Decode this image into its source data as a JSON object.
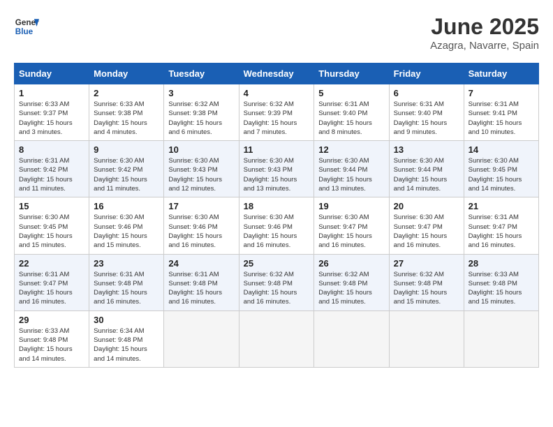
{
  "header": {
    "logo_line1": "General",
    "logo_line2": "Blue",
    "title": "June 2025",
    "subtitle": "Azagra, Navarre, Spain"
  },
  "weekdays": [
    "Sunday",
    "Monday",
    "Tuesday",
    "Wednesday",
    "Thursday",
    "Friday",
    "Saturday"
  ],
  "weeks": [
    [
      {
        "day": "1",
        "info": "Sunrise: 6:33 AM\nSunset: 9:37 PM\nDaylight: 15 hours\nand 3 minutes."
      },
      {
        "day": "2",
        "info": "Sunrise: 6:33 AM\nSunset: 9:38 PM\nDaylight: 15 hours\nand 4 minutes."
      },
      {
        "day": "3",
        "info": "Sunrise: 6:32 AM\nSunset: 9:38 PM\nDaylight: 15 hours\nand 6 minutes."
      },
      {
        "day": "4",
        "info": "Sunrise: 6:32 AM\nSunset: 9:39 PM\nDaylight: 15 hours\nand 7 minutes."
      },
      {
        "day": "5",
        "info": "Sunrise: 6:31 AM\nSunset: 9:40 PM\nDaylight: 15 hours\nand 8 minutes."
      },
      {
        "day": "6",
        "info": "Sunrise: 6:31 AM\nSunset: 9:40 PM\nDaylight: 15 hours\nand 9 minutes."
      },
      {
        "day": "7",
        "info": "Sunrise: 6:31 AM\nSunset: 9:41 PM\nDaylight: 15 hours\nand 10 minutes."
      }
    ],
    [
      {
        "day": "8",
        "info": "Sunrise: 6:31 AM\nSunset: 9:42 PM\nDaylight: 15 hours\nand 11 minutes."
      },
      {
        "day": "9",
        "info": "Sunrise: 6:30 AM\nSunset: 9:42 PM\nDaylight: 15 hours\nand 11 minutes."
      },
      {
        "day": "10",
        "info": "Sunrise: 6:30 AM\nSunset: 9:43 PM\nDaylight: 15 hours\nand 12 minutes."
      },
      {
        "day": "11",
        "info": "Sunrise: 6:30 AM\nSunset: 9:43 PM\nDaylight: 15 hours\nand 13 minutes."
      },
      {
        "day": "12",
        "info": "Sunrise: 6:30 AM\nSunset: 9:44 PM\nDaylight: 15 hours\nand 13 minutes."
      },
      {
        "day": "13",
        "info": "Sunrise: 6:30 AM\nSunset: 9:44 PM\nDaylight: 15 hours\nand 14 minutes."
      },
      {
        "day": "14",
        "info": "Sunrise: 6:30 AM\nSunset: 9:45 PM\nDaylight: 15 hours\nand 14 minutes."
      }
    ],
    [
      {
        "day": "15",
        "info": "Sunrise: 6:30 AM\nSunset: 9:45 PM\nDaylight: 15 hours\nand 15 minutes."
      },
      {
        "day": "16",
        "info": "Sunrise: 6:30 AM\nSunset: 9:46 PM\nDaylight: 15 hours\nand 15 minutes."
      },
      {
        "day": "17",
        "info": "Sunrise: 6:30 AM\nSunset: 9:46 PM\nDaylight: 15 hours\nand 16 minutes."
      },
      {
        "day": "18",
        "info": "Sunrise: 6:30 AM\nSunset: 9:46 PM\nDaylight: 15 hours\nand 16 minutes."
      },
      {
        "day": "19",
        "info": "Sunrise: 6:30 AM\nSunset: 9:47 PM\nDaylight: 15 hours\nand 16 minutes."
      },
      {
        "day": "20",
        "info": "Sunrise: 6:30 AM\nSunset: 9:47 PM\nDaylight: 15 hours\nand 16 minutes."
      },
      {
        "day": "21",
        "info": "Sunrise: 6:31 AM\nSunset: 9:47 PM\nDaylight: 15 hours\nand 16 minutes."
      }
    ],
    [
      {
        "day": "22",
        "info": "Sunrise: 6:31 AM\nSunset: 9:47 PM\nDaylight: 15 hours\nand 16 minutes."
      },
      {
        "day": "23",
        "info": "Sunrise: 6:31 AM\nSunset: 9:48 PM\nDaylight: 15 hours\nand 16 minutes."
      },
      {
        "day": "24",
        "info": "Sunrise: 6:31 AM\nSunset: 9:48 PM\nDaylight: 15 hours\nand 16 minutes."
      },
      {
        "day": "25",
        "info": "Sunrise: 6:32 AM\nSunset: 9:48 PM\nDaylight: 15 hours\nand 16 minutes."
      },
      {
        "day": "26",
        "info": "Sunrise: 6:32 AM\nSunset: 9:48 PM\nDaylight: 15 hours\nand 15 minutes."
      },
      {
        "day": "27",
        "info": "Sunrise: 6:32 AM\nSunset: 9:48 PM\nDaylight: 15 hours\nand 15 minutes."
      },
      {
        "day": "28",
        "info": "Sunrise: 6:33 AM\nSunset: 9:48 PM\nDaylight: 15 hours\nand 15 minutes."
      }
    ],
    [
      {
        "day": "29",
        "info": "Sunrise: 6:33 AM\nSunset: 9:48 PM\nDaylight: 15 hours\nand 14 minutes."
      },
      {
        "day": "30",
        "info": "Sunrise: 6:34 AM\nSunset: 9:48 PM\nDaylight: 15 hours\nand 14 minutes."
      },
      {
        "day": "",
        "info": ""
      },
      {
        "day": "",
        "info": ""
      },
      {
        "day": "",
        "info": ""
      },
      {
        "day": "",
        "info": ""
      },
      {
        "day": "",
        "info": ""
      }
    ]
  ]
}
